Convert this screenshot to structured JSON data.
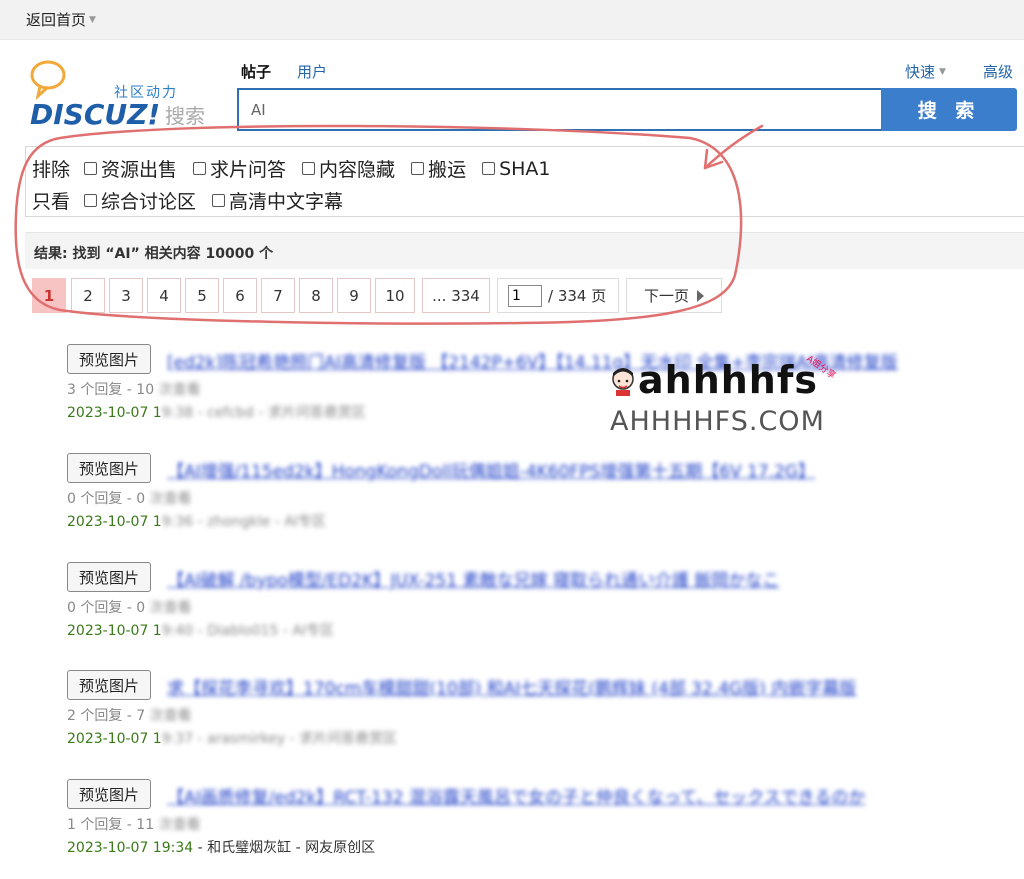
{
  "topbar": {
    "back_home": "返回首页"
  },
  "logo": {
    "cn": "社区动力",
    "main": "DISCUZ!",
    "search": "搜索"
  },
  "tabs": {
    "posts": "帖子",
    "users": "用户",
    "quick": "快速",
    "advanced": "高级"
  },
  "search": {
    "value": "AI",
    "button": "搜 索"
  },
  "filters": {
    "exclude_label": "排除",
    "exclude": [
      "资源出售",
      "求片问答",
      "内容隐藏",
      "搬运",
      "SHA1"
    ],
    "only_label": "只看",
    "only": [
      "综合讨论区",
      "高清中文字幕"
    ]
  },
  "result": {
    "text": "结果: 找到 “AI” 相关内容 10000 个"
  },
  "pager": {
    "pages": [
      "1",
      "2",
      "3",
      "4",
      "5",
      "6",
      "7",
      "8",
      "9",
      "10",
      "... 334"
    ],
    "current": "1",
    "jump_value": "1",
    "jump_total": "/ 334 页",
    "next": "下一页"
  },
  "items": [
    {
      "preview": "预览图片",
      "title": "[ed2k]陈冠希艳照门AI高清修复版 【2142P+6V】【14.11g】无水印 全集+李宗瑞AI高清修复版",
      "replies": "3 个回复 - 10",
      "views": " 次查看",
      "date": "2023-10-07 1",
      "date_rest": "9:38 - cefcbd - 求片问答悬赏区"
    },
    {
      "preview": "预览图片",
      "title": "【AI增强/115ed2k】HongKongDoll玩偶姐姐-4K60FPS增强第十五期【6V 17.2G】",
      "replies": "0 个回复 - 0",
      "views": " 次查看",
      "date": "2023-10-07 1",
      "date_rest": "9:36 - zhongkle - AI专区"
    },
    {
      "preview": "预览图片",
      "title": "【AI破解 /bypo模型/ED2K】JUX-251 素敵な兄嫁 寝取られ通い介護 飯岡かなこ",
      "replies": "0 个回复 - 0",
      "views": " 次查看",
      "date": "2023-10-07 1",
      "date_rest": "9:40 - Diablo015 - AI专区"
    },
    {
      "preview": "预览图片",
      "title": "求【探花李寻欢】170cm车模甜甜(10部) 和AI七天探花(鹏辉妹 (4部 32.4G版) 内嵌字幕版",
      "replies": "2 个回复 - 7",
      "views": " 次查看",
      "date": "2023-10-07 1",
      "date_rest": "9:37 - arasmirkey - 求片问答悬赏区"
    },
    {
      "preview": "预览图片",
      "title": "【AI画质修复/ed2k】RCT-132 混浴露天風呂で女の子と仲良くなって、セックスできるのか",
      "replies": "1 个回复 - 11",
      "views": " 次查看",
      "date": "2023-10-07 19:34",
      "date_rest": " - 和氏璧烟灰缸 - 网友原创区"
    }
  ],
  "watermark": {
    "brand": "ahhhhfs",
    "tag": "A姐分享",
    "domain": "AHHHHFS.COM"
  },
  "colors": {
    "accent": "#3b7ecb",
    "link": "#2366a8",
    "date_green": "#3a7a1a",
    "current_page": "#f7c3c3",
    "annotation": "#e07070"
  }
}
